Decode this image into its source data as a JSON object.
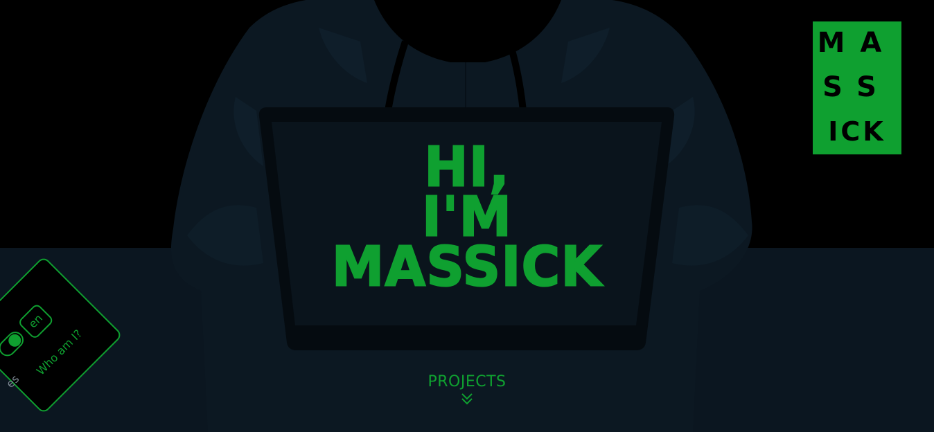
{
  "hero": {
    "line1": "HI,",
    "line2": "I'M",
    "line3": "MASSICK"
  },
  "logo": {
    "row1": "MA",
    "row2": "SS",
    "row3": "ICK"
  },
  "nav": {
    "projects_label": "PROJECTS"
  },
  "lang_menu": {
    "option_en": "en",
    "option_es": "es",
    "whoami_label": "Who am I?",
    "selected": "en"
  },
  "colors": {
    "accent": "#0fa030",
    "background": "#000000",
    "desk": "#0b1620",
    "silhouette": "#0c1822"
  },
  "icons": {
    "projects_chevron": "double-chevron-down-icon",
    "toggle": "toggle-icon"
  }
}
